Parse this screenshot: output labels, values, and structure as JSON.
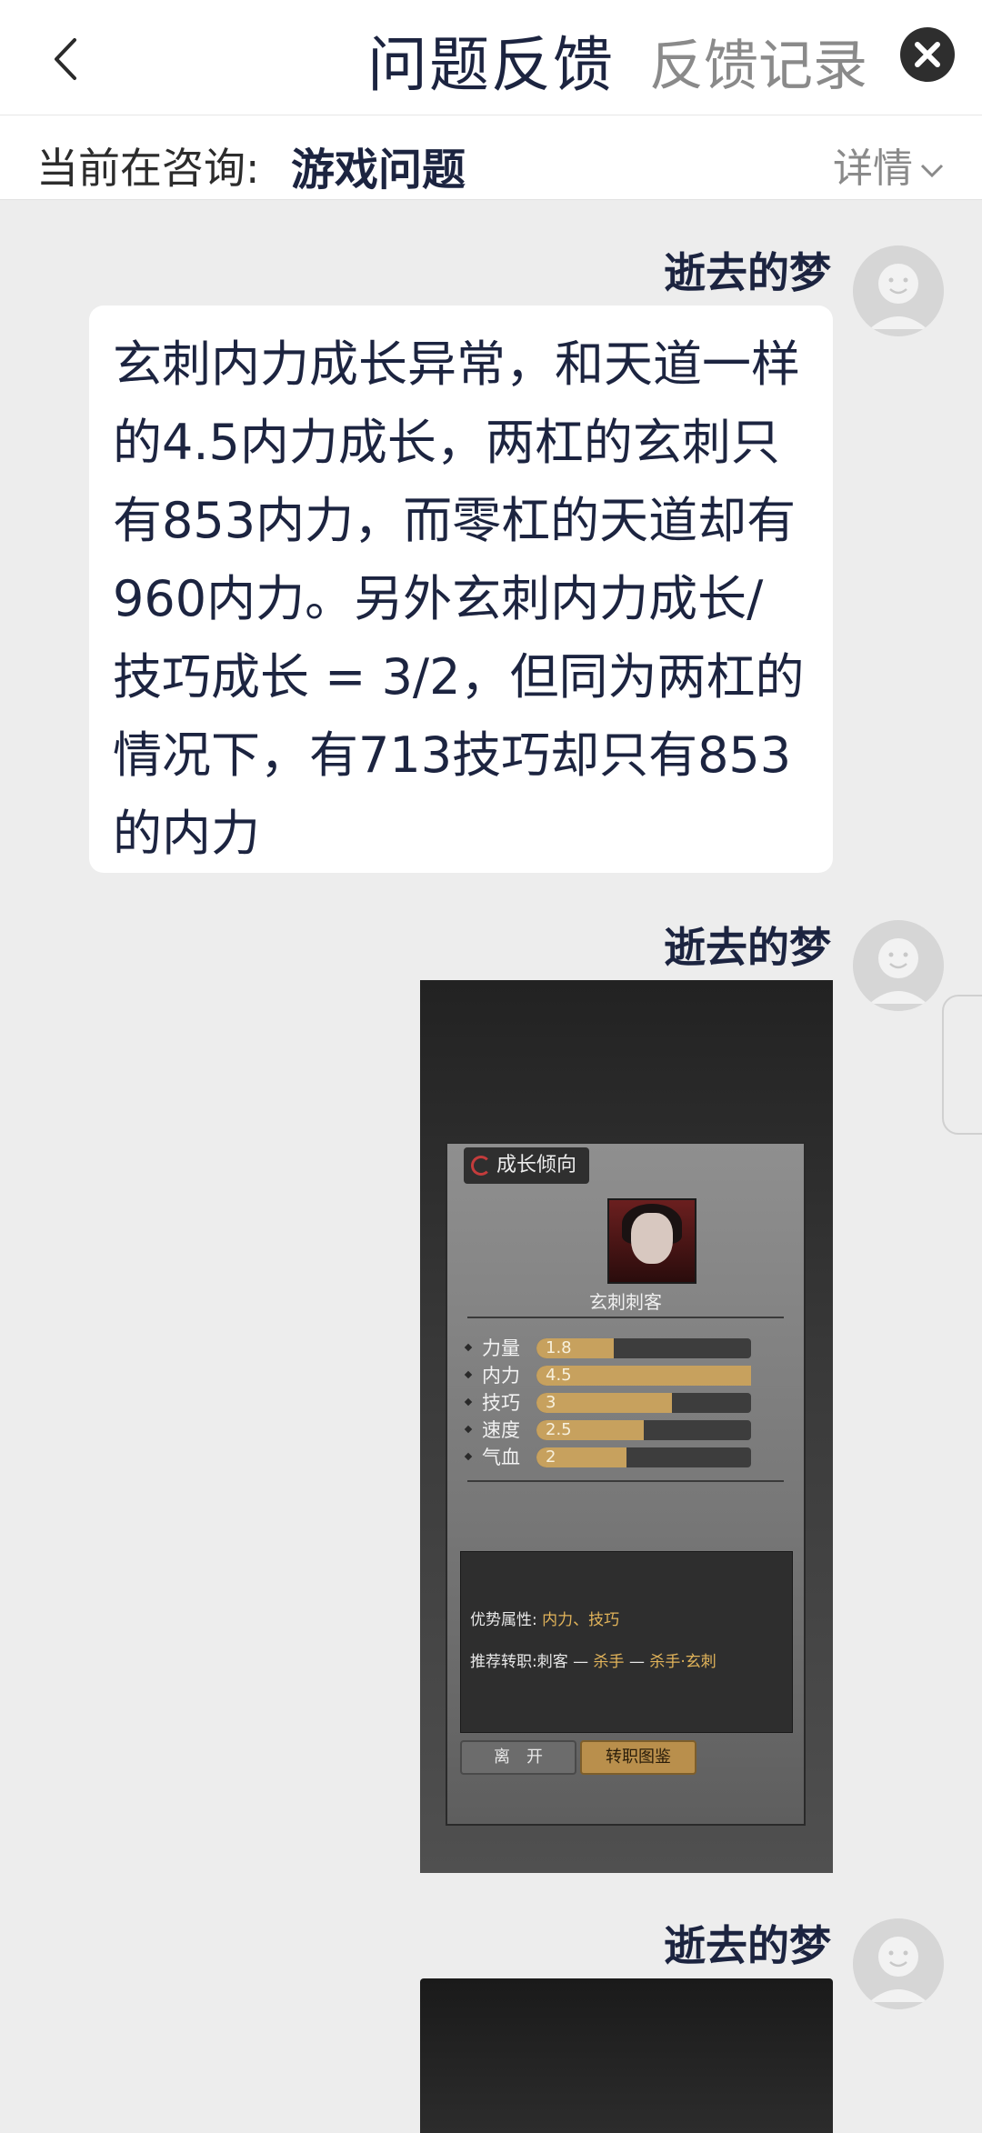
{
  "header": {
    "title": "问题反馈",
    "records_label": "反馈记录"
  },
  "consult_bar": {
    "label": "当前在咨询:",
    "topic": "游戏问题",
    "details_label": "详情"
  },
  "messages": [
    {
      "sender": "逝去的梦",
      "type": "text",
      "text": "玄刺内力成长异常，和天道一样的4.5内力成长，两杠的玄刺只有853内力，而零杠的天道却有960内力。另外玄刺内力成长/技巧成长 = 3/2，但同为两杠的情况下，有713技巧却只有853的内力"
    },
    {
      "sender": "逝去的梦",
      "type": "image",
      "game": {
        "panel_title": "成长倾向",
        "class_name": "玄刺刺客",
        "stats": [
          {
            "label": "力量",
            "value": "1.8",
            "ratio": 0.36
          },
          {
            "label": "内力",
            "value": "4.5",
            "ratio": 1.0
          },
          {
            "label": "技巧",
            "value": "3",
            "ratio": 0.63
          },
          {
            "label": "速度",
            "value": "2.5",
            "ratio": 0.5
          },
          {
            "label": "气血",
            "value": "2",
            "ratio": 0.42
          }
        ],
        "advantage_label": "优势属性:",
        "advantage_value": "内力、技巧",
        "path_label": "推荐转职:",
        "path_1": "刺客",
        "path_sep_1": "—",
        "path_2": "杀手",
        "path_sep_2": "—",
        "path_3": "杀手·玄刺",
        "leave_button": "离　开",
        "codex_button": "转职图鉴"
      }
    },
    {
      "sender": "逝去的梦",
      "type": "image"
    }
  ],
  "colors": {
    "accent_gold": "#c7a15e",
    "page_bg": "#ededed",
    "title_text": "#1c2440"
  }
}
